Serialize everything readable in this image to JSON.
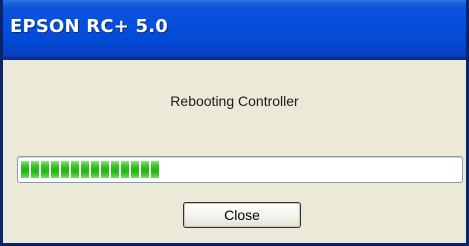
{
  "window": {
    "title": "EPSON RC+ 5.0"
  },
  "dialog": {
    "message": "Rebooting Controller",
    "progress_fraction": 0.33,
    "close_label": "Close"
  },
  "colors": {
    "title_bar": "#0550dd",
    "dialog_bg": "#ece9d8",
    "progress_green": "#22b214"
  }
}
